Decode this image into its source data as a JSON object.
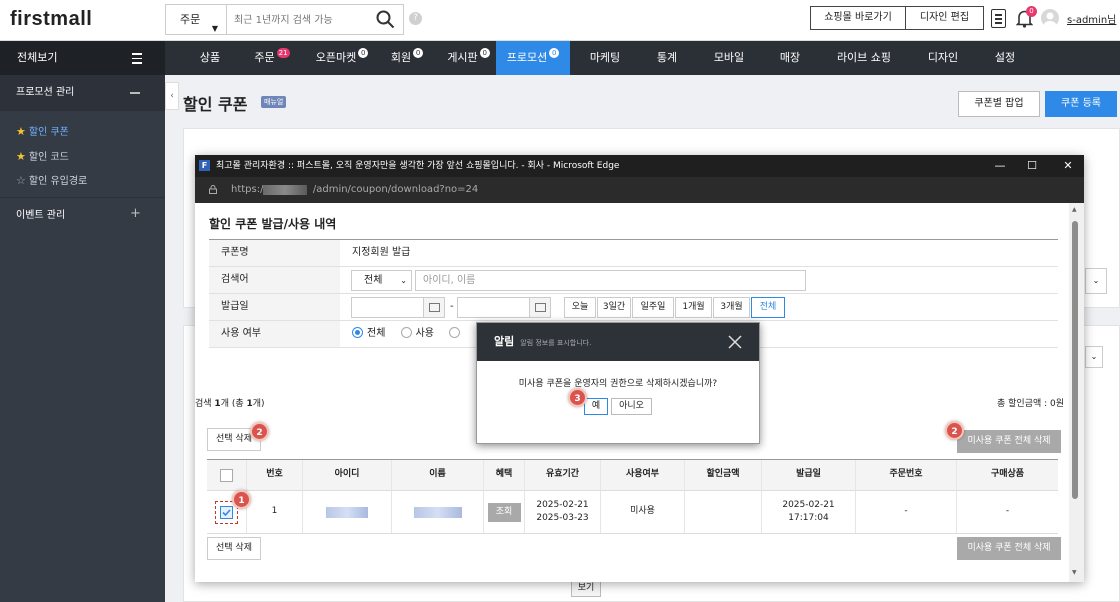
{
  "header": {
    "logo": "firstmall",
    "search_select": "주문",
    "search_placeholder": "최근 1년까지 검색 가능",
    "help": "?",
    "shop_btn": "쇼핑몰 바로가기",
    "design_btn": "디자인 편집",
    "bell_count": "0",
    "user": "s-admin님"
  },
  "nav": {
    "all_view": "전체보기",
    "items": [
      {
        "label": "상품"
      },
      {
        "label": "주문",
        "badge": "21"
      },
      {
        "label": "오픈마켓",
        "badge": "0"
      },
      {
        "label": "회원",
        "badge": "0"
      },
      {
        "label": "게시판",
        "badge": "0"
      },
      {
        "label": "프로모션",
        "badge": "0",
        "active": true
      },
      {
        "label": "마케팅"
      },
      {
        "label": "통계"
      },
      {
        "label": "모바일"
      },
      {
        "label": "매장"
      },
      {
        "label": "라이브 쇼핑"
      },
      {
        "label": "디자인"
      },
      {
        "label": "설정"
      }
    ]
  },
  "sidebar": {
    "section": "프로모션 관리",
    "items": [
      {
        "label": "할인 쿠폰"
      },
      {
        "label": "할인 코드"
      },
      {
        "label": "할인 유입경로"
      }
    ],
    "event_section": "이벤트 관리"
  },
  "page": {
    "title": "할인 쿠폰",
    "manual_badge": "매뉴얼",
    "popup_btn": "쿠폰별 팝업",
    "register_btn": "쿠폰 등록",
    "bg_view_btn": "보기"
  },
  "browser": {
    "title": "최고몰 관리자환경 :: 퍼스트몰, 오직 운영자만을 생각한 가장 앞선 쇼핑몰입니다. - 회사 - Microsoft Edge",
    "url_prefix": "https://",
    "url_path": "/admin/coupon/download?no=24"
  },
  "content": {
    "title": "할인 쿠폰 발급/사용 내역",
    "form": {
      "coupon_name_label": "쿠폰명",
      "coupon_name": "지정회원 발급",
      "search_label": "검색어",
      "search_select": "전체",
      "search_placeholder": "아이디, 이름",
      "issue_label": "발급일",
      "date_sep": "-",
      "periods": [
        "오늘",
        "3일간",
        "일주일",
        "1개월",
        "3개월",
        "전체"
      ],
      "use_label": "사용 여부",
      "use_options": [
        "전체",
        "사용"
      ]
    },
    "count_prefix": "검색 ",
    "count_num": "1",
    "count_mid": "개 (총 ",
    "count_total": "1",
    "count_suffix": "개)",
    "total_amount": "총 할인금액 : 0원",
    "delete_selected": "선택 삭제",
    "delete_unused_all": "미사용 쿠폰 전체 삭제",
    "columns": [
      "번호",
      "아이디",
      "이름",
      "혜택",
      "유효기간",
      "사용여부",
      "할인금액",
      "발급일",
      "주문번호",
      "구매상품"
    ],
    "rows": [
      {
        "no": "1",
        "benefit_btn": "조회",
        "valid_from": "2025-02-21",
        "valid_to": "2025-03-23",
        "status": "미사용",
        "discount": "",
        "issue_date": "2025-02-21",
        "issue_time": "17:17:04",
        "order_no": "-",
        "product": "-"
      }
    ]
  },
  "alert": {
    "title": "알림",
    "subtitle": "알림 정보를 표시합니다.",
    "message": "미사용 쿠폰을 운영자의 권한으로 삭제하시겠습니까?",
    "yes": "예",
    "no": "아니오"
  },
  "callouts": {
    "step1": "1",
    "step2": "2",
    "step3": "3"
  },
  "colors": {
    "accent": "#2e8ae6",
    "nav_bg": "#2b2f36",
    "badge_red": "#d9534f"
  }
}
